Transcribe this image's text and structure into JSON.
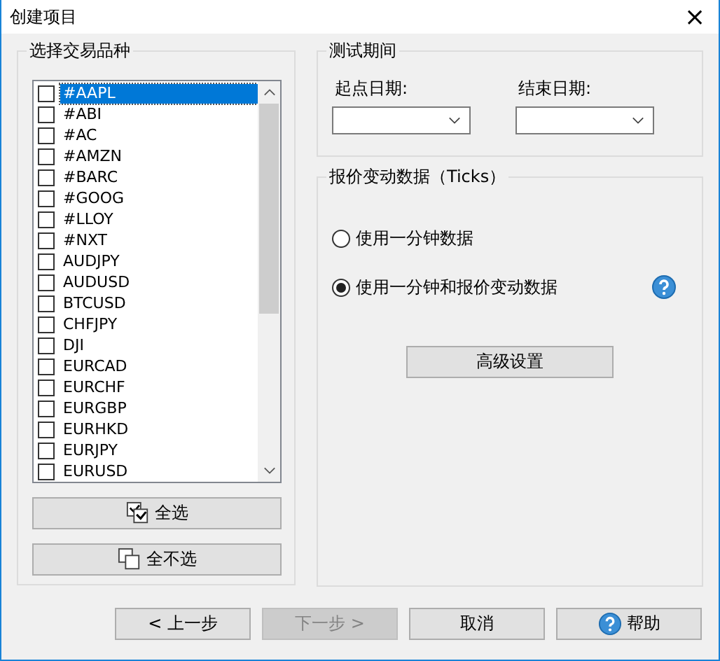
{
  "window": {
    "title": "创建项目",
    "close": "×"
  },
  "symbols_group": {
    "label": "选择交易品种",
    "items": [
      {
        "label": "#AAPL",
        "checked": false,
        "selected": true
      },
      {
        "label": "#ABI",
        "checked": false,
        "selected": false
      },
      {
        "label": "#AC",
        "checked": false,
        "selected": false
      },
      {
        "label": "#AMZN",
        "checked": false,
        "selected": false
      },
      {
        "label": "#BARC",
        "checked": false,
        "selected": false
      },
      {
        "label": "#GOOG",
        "checked": false,
        "selected": false
      },
      {
        "label": "#LLOY",
        "checked": false,
        "selected": false
      },
      {
        "label": "#NXT",
        "checked": false,
        "selected": false
      },
      {
        "label": "AUDJPY",
        "checked": false,
        "selected": false
      },
      {
        "label": "AUDUSD",
        "checked": false,
        "selected": false
      },
      {
        "label": "BTCUSD",
        "checked": false,
        "selected": false
      },
      {
        "label": "CHFJPY",
        "checked": false,
        "selected": false
      },
      {
        "label": "DJI",
        "checked": false,
        "selected": false
      },
      {
        "label": "EURCAD",
        "checked": false,
        "selected": false
      },
      {
        "label": "EURCHF",
        "checked": false,
        "selected": false
      },
      {
        "label": "EURGBP",
        "checked": false,
        "selected": false
      },
      {
        "label": "EURHKD",
        "checked": false,
        "selected": false
      },
      {
        "label": "EURJPY",
        "checked": false,
        "selected": false
      },
      {
        "label": "EURUSD",
        "checked": false,
        "selected": false
      }
    ],
    "select_all": "全选",
    "deselect_all": "全不选"
  },
  "test_period": {
    "label": "测试期间",
    "start_label": "起点日期:",
    "end_label": "结束日期:"
  },
  "ticks_group": {
    "label": "报价变动数据（Ticks）",
    "options": [
      {
        "label": "使用一分钟数据",
        "selected": false,
        "help": false
      },
      {
        "label": "使用一分钟和报价变动数据",
        "selected": true,
        "help": true
      }
    ],
    "advanced": "高级设置"
  },
  "footer": [
    {
      "label": "< 上一步",
      "disabled": false,
      "help": false
    },
    {
      "label": "下一步 >",
      "disabled": true,
      "help": false
    },
    {
      "label": "取消",
      "disabled": false,
      "help": false
    },
    {
      "label": "帮助",
      "disabled": false,
      "help": true
    }
  ]
}
